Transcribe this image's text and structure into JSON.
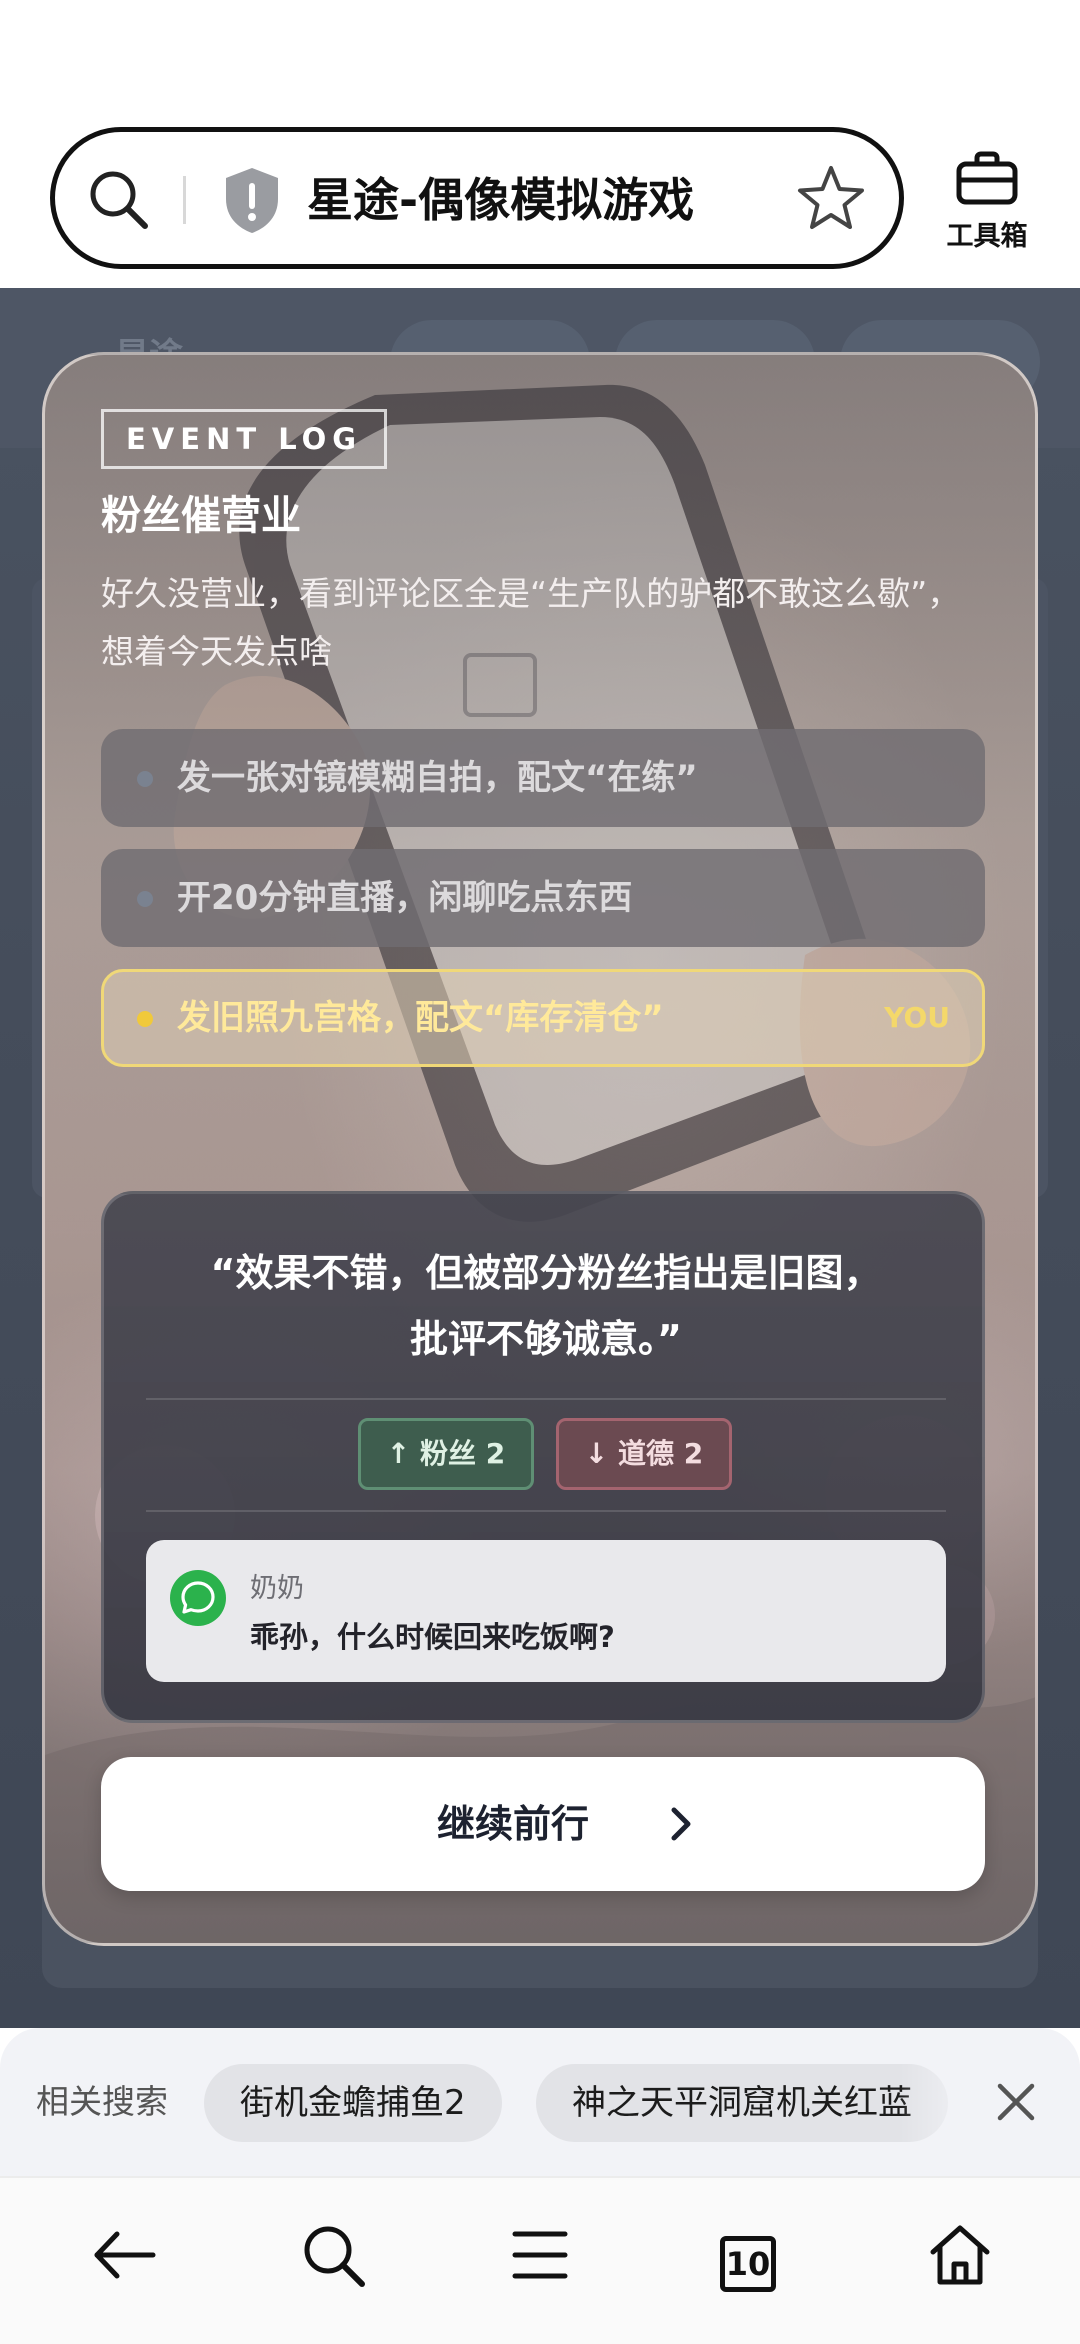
{
  "browser": {
    "page_title": "星途-偶像模拟游戏",
    "toolbox_label": "工具箱"
  },
  "background_page": {
    "logo_text": "星途"
  },
  "event": {
    "badge": "EVENT LOG",
    "title": "粉丝催营业",
    "description": "好久没营业，看到评论区全是“生产队的驴都不敢这么歇”，想着今天发点啥",
    "choices": [
      {
        "label": "发一张对镜模糊自拍，配文“在练”",
        "selected": false
      },
      {
        "label": "开20分钟直播，闲聊吃点东西",
        "selected": false
      },
      {
        "label": "发旧照九宫格，配文“库存清仓”",
        "selected": true,
        "tag": "YOU"
      }
    ]
  },
  "result": {
    "quote_line1": "“效果不错，但被部分粉丝指出是旧图，",
    "quote_line2": "批评不够诚意。”",
    "stat_up": "↑ 粉丝 2",
    "stat_down": "↓ 道德 2",
    "message": {
      "sender": "奶奶",
      "text": "乖孙，什么时候回来吃饭啊?"
    }
  },
  "continue_label": "继续前行",
  "related_search": {
    "label": "相关搜索",
    "chips": [
      "街机金蟾捕鱼2",
      "神之天平洞窟机关红蓝"
    ]
  },
  "bottom_nav": {
    "tab_count": "10"
  },
  "colors": {
    "selected_accent": "#f0d878",
    "stat_up": "#3e5d4e",
    "stat_down": "#6b4a51",
    "message_app_green": "#2bb24c"
  }
}
